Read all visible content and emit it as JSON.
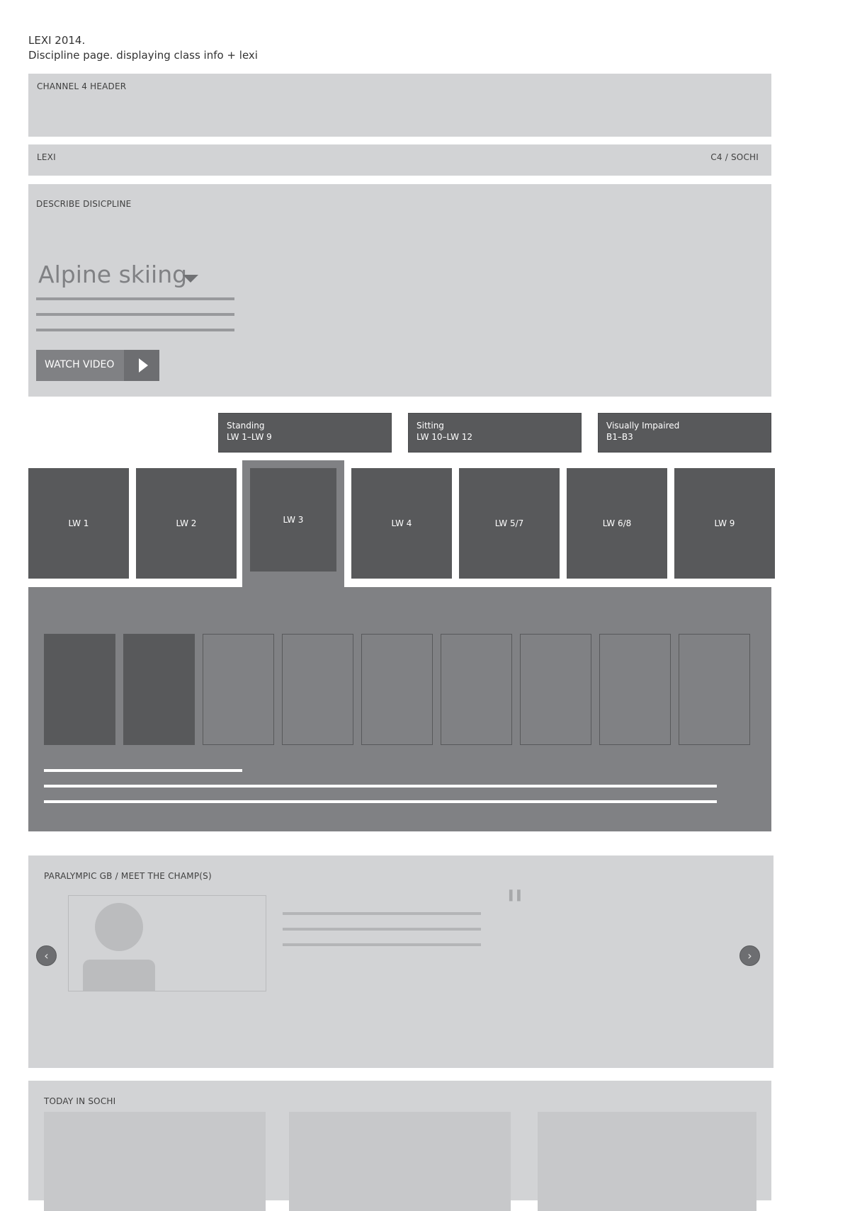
{
  "doc": {
    "title_line1": "LEXI 2014.",
    "title_line2": "Discipline page. displaying class info + lexi"
  },
  "header": {
    "label": "CHANNEL 4 HEADER"
  },
  "lexi_bar": {
    "left": "LEXI",
    "right": "C4 / SOCHI"
  },
  "discipline": {
    "section_label": "DESCRIBE DISICPLINE",
    "selected": "Alpine skiing",
    "watch_video_label": "WATCH VIDEO"
  },
  "category_tabs": [
    {
      "line1": "Standing",
      "line2": "LW 1–LW 9"
    },
    {
      "line1": "Sitting",
      "line2": "LW 10–LW 12"
    },
    {
      "line1": "Visually Impaired",
      "line2": "B1–B3"
    }
  ],
  "classes": [
    "LW 1",
    "LW 2",
    "LW 3",
    "LW 4",
    "LW 5/7",
    "LW 6/8",
    "LW 9"
  ],
  "selected_class": "LW 3",
  "champs": {
    "section_label": "PARALYMPIC GB / MEET THE CHAMP(S)",
    "quote_mark": "\""
  },
  "today": {
    "section_label": "TODAY IN SOCHI"
  },
  "icons": {
    "dropdown": "chevron-down-icon",
    "play": "play-icon",
    "prev": "chevron-left-icon",
    "next": "chevron-right-icon",
    "quote": "quote-icon"
  },
  "colors": {
    "panel_light": "#d2d3d5",
    "tile_dark": "#58595b",
    "panel_mid": "#808184"
  }
}
